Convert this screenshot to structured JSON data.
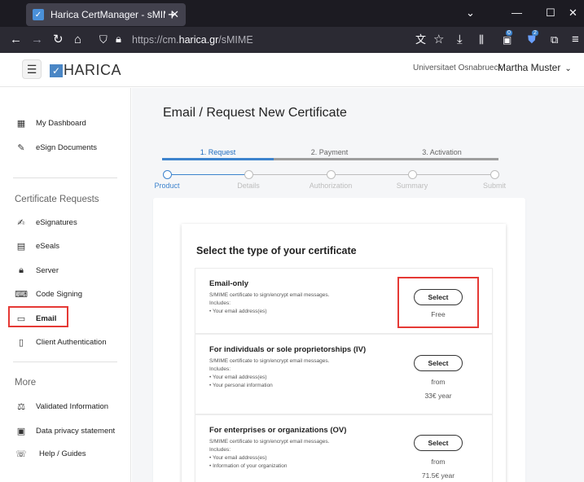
{
  "browser": {
    "tab_title": "Harica CertManager - sMIME",
    "url_prefix": "https://cm.",
    "url_domain": "harica.gr",
    "url_path": "/sMIME",
    "downloads_badge": "0",
    "ext_badge": "2"
  },
  "header": {
    "logo_text": "HARICA",
    "organization": "Universitaet Osnabrueck",
    "user_name": "Martha Muster"
  },
  "sidebar": {
    "top_items": [
      {
        "label": "My Dashboard",
        "icon": "dashboard-icon"
      },
      {
        "label": "eSign Documents",
        "icon": "esign-icon"
      }
    ],
    "section_requests": "Certificate Requests",
    "request_items": [
      {
        "label": "eSignatures",
        "icon": "signature-icon"
      },
      {
        "label": "eSeals",
        "icon": "seal-icon"
      },
      {
        "label": "Server",
        "icon": "lock-icon"
      },
      {
        "label": "Code Signing",
        "icon": "terminal-icon"
      },
      {
        "label": "Email",
        "icon": "email-card-icon"
      },
      {
        "label": "Client Authentication",
        "icon": "id-badge-icon"
      }
    ],
    "section_more": "More",
    "more_items": [
      {
        "label": "Validated Information",
        "icon": "balance-icon"
      },
      {
        "label": "Data privacy statement",
        "icon": "privacy-icon"
      },
      {
        "label": "Help / Guides",
        "icon": "help-icon"
      }
    ]
  },
  "main": {
    "title": "Email / Request New Certificate",
    "steps": [
      "1. Request",
      "2. Payment",
      "3. Activation"
    ],
    "progress": [
      "Product",
      "Details",
      "Authorization",
      "Summary",
      "Submit"
    ],
    "card_title": "Select the type of your certificate",
    "options": [
      {
        "name": "Email-only",
        "desc1": "S/MIME certificate to sign/encrypt email messages.",
        "desc2": "Includes:",
        "desc3": "• Your email address(es)",
        "desc4": "",
        "button": "Select",
        "price1": "Free",
        "price2": ""
      },
      {
        "name": "For individuals or sole proprietorships (IV)",
        "desc1": "S/MIME certificate to sign/encrypt email messages.",
        "desc2": "Includes:",
        "desc3": "• Your email address(es)",
        "desc4": "• Your personal information",
        "button": "Select",
        "price1": "from",
        "price2": "33€ year"
      },
      {
        "name": "For enterprises or organizations (OV)",
        "desc1": "S/MIME certificate to sign/encrypt email messages.",
        "desc2": "Includes:",
        "desc3": "• Your email address(es)",
        "desc4": "• Information of your organization",
        "button": "Select",
        "price1": "from",
        "price2": "71.5€ year"
      }
    ]
  },
  "colors": {
    "accent": "#3d83cd",
    "highlight": "#e53935"
  }
}
